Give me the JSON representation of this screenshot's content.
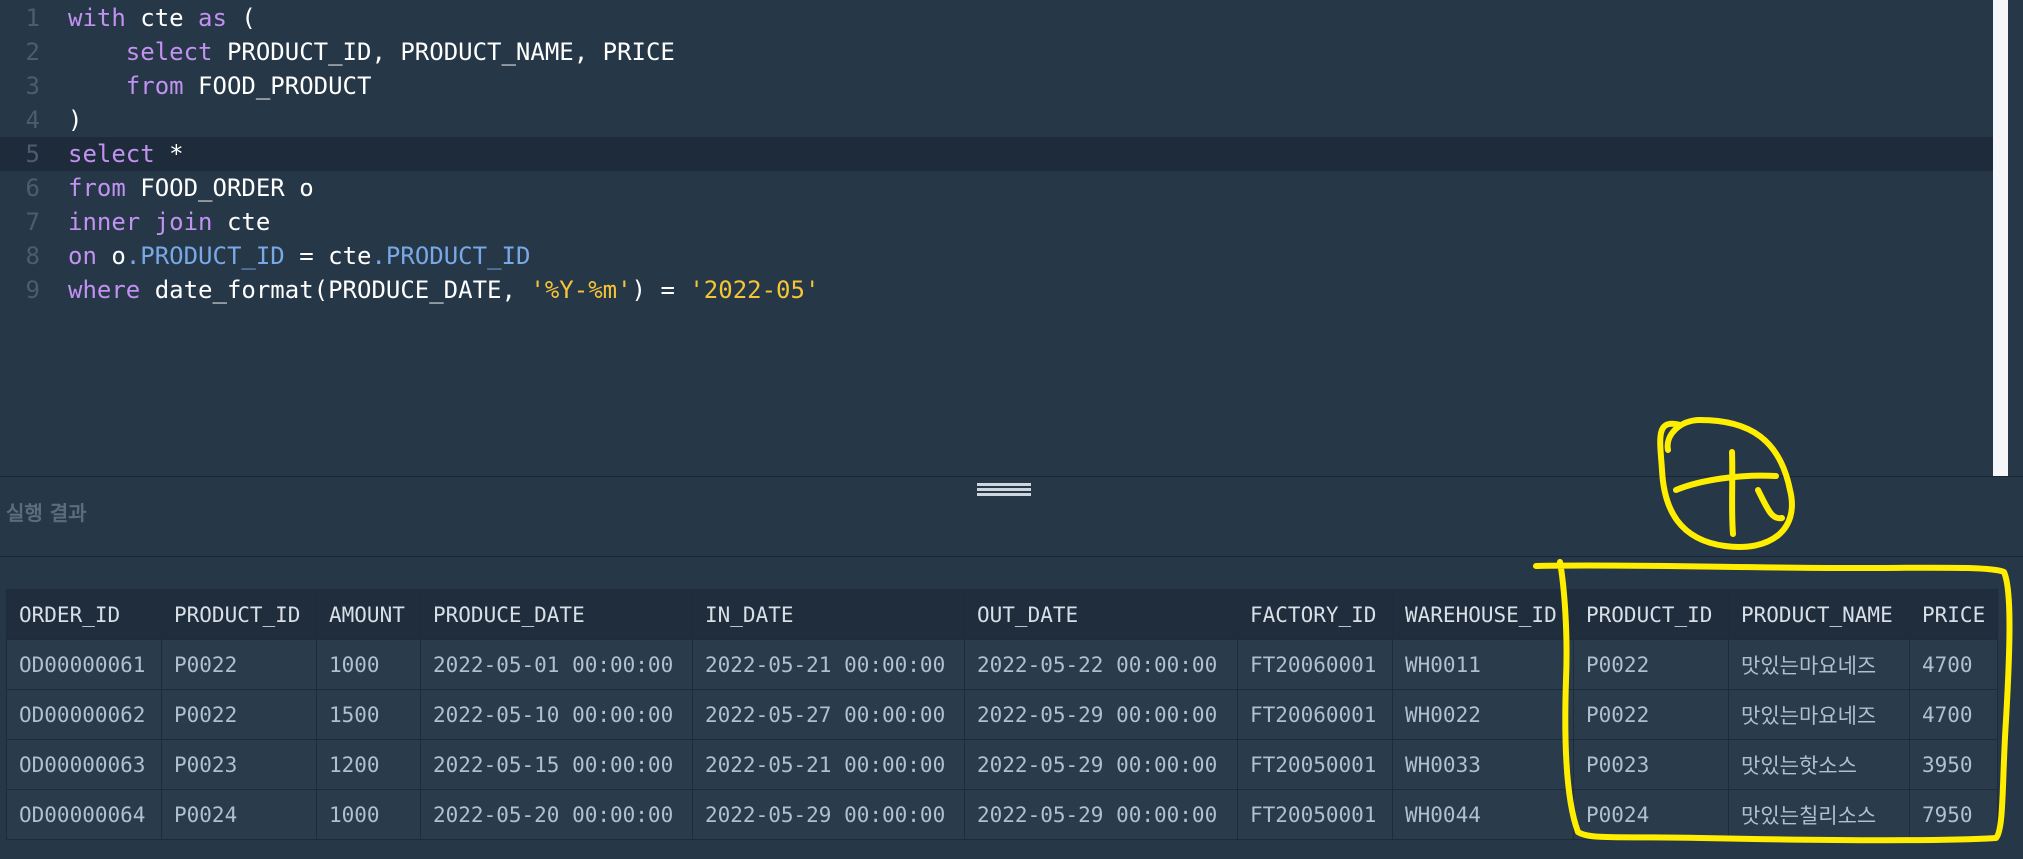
{
  "editor": {
    "lines": [
      {
        "num": "1",
        "tokens": [
          {
            "t": "with",
            "c": "kw"
          },
          {
            "t": " cte ",
            "c": "ident"
          },
          {
            "t": "as",
            "c": "kw"
          },
          {
            "t": " (",
            "c": "ident"
          }
        ]
      },
      {
        "num": "2",
        "tokens": [
          {
            "t": "    ",
            "c": "ident"
          },
          {
            "t": "select",
            "c": "kw"
          },
          {
            "t": " PRODUCT_ID, PRODUCT_NAME, PRICE",
            "c": "ident"
          }
        ]
      },
      {
        "num": "3",
        "tokens": [
          {
            "t": "    ",
            "c": "ident"
          },
          {
            "t": "from",
            "c": "kw"
          },
          {
            "t": " FOOD_PRODUCT",
            "c": "ident"
          }
        ]
      },
      {
        "num": "4",
        "tokens": [
          {
            "t": ")",
            "c": "ident"
          }
        ]
      },
      {
        "num": "5",
        "active": true,
        "tokens": [
          {
            "t": "select",
            "c": "kw"
          },
          {
            "t": " *",
            "c": "ident"
          }
        ]
      },
      {
        "num": "6",
        "tokens": [
          {
            "t": "from",
            "c": "kw"
          },
          {
            "t": " FOOD_ORDER o",
            "c": "ident"
          }
        ]
      },
      {
        "num": "7",
        "tokens": [
          {
            "t": "inner",
            "c": "kw"
          },
          {
            "t": " ",
            "c": "ident"
          },
          {
            "t": "join",
            "c": "kw"
          },
          {
            "t": " cte",
            "c": "ident"
          }
        ]
      },
      {
        "num": "8",
        "tokens": [
          {
            "t": "on",
            "c": "kw"
          },
          {
            "t": " o",
            "c": "ident"
          },
          {
            "t": ".PRODUCT_ID",
            "c": "prop"
          },
          {
            "t": " = cte",
            "c": "ident"
          },
          {
            "t": ".PRODUCT_ID",
            "c": "prop"
          }
        ]
      },
      {
        "num": "9",
        "tokens": [
          {
            "t": "where",
            "c": "kw"
          },
          {
            "t": " date_format(PRODUCE_DATE, ",
            "c": "ident"
          },
          {
            "t": "'%Y-%m'",
            "c": "str"
          },
          {
            "t": ") = ",
            "c": "ident"
          },
          {
            "t": "'2022-05'",
            "c": "str"
          }
        ]
      }
    ]
  },
  "result": {
    "label": "실행 결과",
    "columns": [
      "ORDER_ID",
      "PRODUCT_ID",
      "AMOUNT",
      "PRODUCE_DATE",
      "IN_DATE",
      "OUT_DATE",
      "FACTORY_ID",
      "WAREHOUSE_ID",
      "PRODUCT_ID",
      "PRODUCT_NAME",
      "PRICE"
    ],
    "rows": [
      [
        "OD00000061",
        "P0022",
        "1000",
        "2022-05-01 00:00:00",
        "2022-05-21 00:00:00",
        "2022-05-22 00:00:00",
        "FT20060001",
        "WH0011",
        "P0022",
        "맛있는마요네즈",
        "4700"
      ],
      [
        "OD00000062",
        "P0022",
        "1500",
        "2022-05-10 00:00:00",
        "2022-05-27 00:00:00",
        "2022-05-29 00:00:00",
        "FT20060001",
        "WH0022",
        "P0022",
        "맛있는마요네즈",
        "4700"
      ],
      [
        "OD00000063",
        "P0023",
        "1200",
        "2022-05-15 00:00:00",
        "2022-05-21 00:00:00",
        "2022-05-29 00:00:00",
        "FT20050001",
        "WH0033",
        "P0023",
        "맛있는핫소스",
        "3950"
      ],
      [
        "OD00000064",
        "P0024",
        "1000",
        "2022-05-20 00:00:00",
        "2022-05-29 00:00:00",
        "2022-05-29 00:00:00",
        "FT20050001",
        "WH0044",
        "P0024",
        "맛있는칠리소스",
        "7950"
      ]
    ]
  },
  "colors": {
    "background": "#263747",
    "keyword": "#c192f0",
    "property": "#78a9e6",
    "string": "#f6c536",
    "annotation": "#ffee00"
  }
}
